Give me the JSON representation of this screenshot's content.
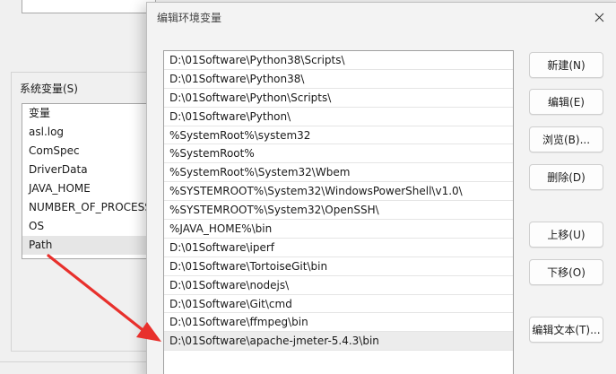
{
  "background": {
    "group_label": "系统变量(S)",
    "list_items": [
      {
        "label": "变量",
        "selected": false
      },
      {
        "label": "asl.log",
        "selected": false
      },
      {
        "label": "ComSpec",
        "selected": false
      },
      {
        "label": "DriverData",
        "selected": false
      },
      {
        "label": "JAVA_HOME",
        "selected": false
      },
      {
        "label": "NUMBER_OF_PROCESSORS",
        "selected": false
      },
      {
        "label": "OS",
        "selected": false
      },
      {
        "label": "Path",
        "selected": true
      }
    ]
  },
  "dialog": {
    "title": "编辑环境变量",
    "close_icon": "close-icon",
    "paths": [
      {
        "value": "D:\\01Software\\Python38\\Scripts\\",
        "selected": false
      },
      {
        "value": "D:\\01Software\\Python38\\",
        "selected": false
      },
      {
        "value": "D:\\01Software\\Python\\Scripts\\",
        "selected": false
      },
      {
        "value": "D:\\01Software\\Python\\",
        "selected": false
      },
      {
        "value": "%SystemRoot%\\system32",
        "selected": false
      },
      {
        "value": "%SystemRoot%",
        "selected": false
      },
      {
        "value": "%SystemRoot%\\System32\\Wbem",
        "selected": false
      },
      {
        "value": "%SYSTEMROOT%\\System32\\WindowsPowerShell\\v1.0\\",
        "selected": false
      },
      {
        "value": "%SYSTEMROOT%\\System32\\OpenSSH\\",
        "selected": false
      },
      {
        "value": "%JAVA_HOME%\\bin",
        "selected": false
      },
      {
        "value": "D:\\01Software\\iperf",
        "selected": false
      },
      {
        "value": "D:\\01Software\\TortoiseGit\\bin",
        "selected": false
      },
      {
        "value": "D:\\01Software\\nodejs\\",
        "selected": false
      },
      {
        "value": "D:\\01Software\\Git\\cmd",
        "selected": false
      },
      {
        "value": "D:\\01Software\\ffmpeg\\bin",
        "selected": false
      },
      {
        "value": "D:\\01Software\\apache-jmeter-5.4.3\\bin",
        "selected": true
      }
    ],
    "buttons": {
      "new": "新建(N)",
      "edit": "编辑(E)",
      "browse": "浏览(B)...",
      "delete": "删除(D)",
      "move_up": "上移(U)",
      "move_down": "下移(O)",
      "edit_text": "编辑文本(T)..."
    }
  },
  "colors": {
    "arrow": "#e8302c",
    "selected_row": "#ececec"
  }
}
